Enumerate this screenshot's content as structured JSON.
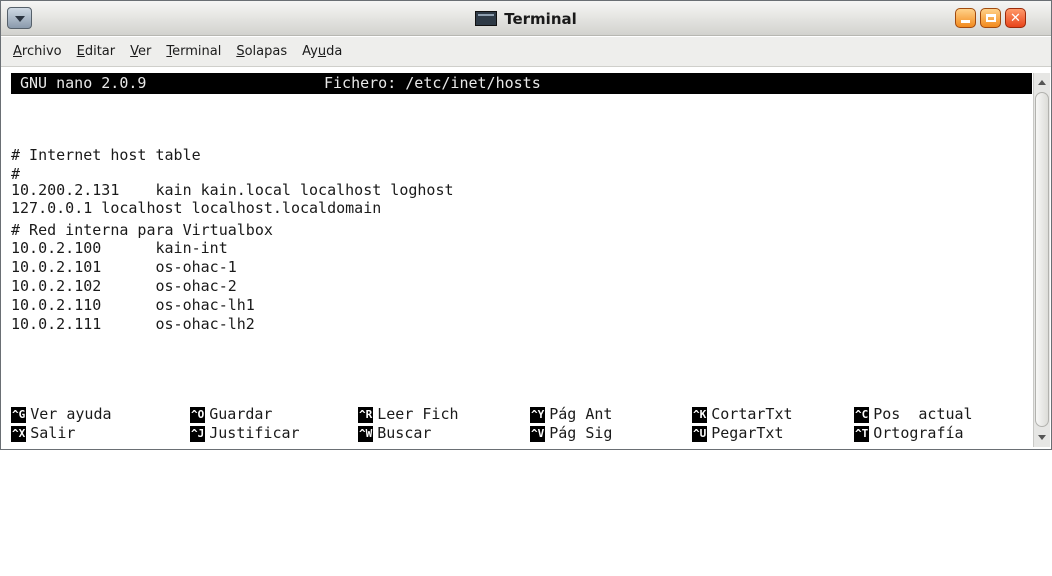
{
  "window": {
    "title": "Terminal",
    "controls": [
      "minimize-icon",
      "maximize-icon",
      "close-icon"
    ]
  },
  "menubar": {
    "items": [
      {
        "pre": "",
        "u": "A",
        "post": "rchivo"
      },
      {
        "pre": "",
        "u": "E",
        "post": "ditar"
      },
      {
        "pre": "",
        "u": "V",
        "post": "er"
      },
      {
        "pre": "",
        "u": "T",
        "post": "erminal"
      },
      {
        "pre": "",
        "u": "S",
        "post": "olapas"
      },
      {
        "pre": "Ay",
        "u": "u",
        "post": "da"
      }
    ]
  },
  "nano": {
    "version": "GNU nano 2.0.9",
    "file_label": "Fichero: /etc/inet/hosts"
  },
  "content": {
    "lines": [
      "",
      "# Internet host table",
      "#",
      "10.200.2.131    kain kain.local localhost loghost",
      "127.0.0.1 localhost localhost.localdomain",
      "",
      "# Red interna para Virtualbox",
      "10.0.2.100      kain-int",
      "10.0.2.101      os-ohac-1",
      "10.0.2.102      os-ohac-2",
      "10.0.2.110      os-ohac-lh1",
      "10.0.2.111      os-ohac-lh2"
    ]
  },
  "shortcuts": {
    "row1": [
      {
        "key": "^G",
        "label": "Ver ayuda"
      },
      {
        "key": "^O",
        "label": "Guardar"
      },
      {
        "key": "^R",
        "label": "Leer Fich"
      },
      {
        "key": "^Y",
        "label": "Pág Ant"
      },
      {
        "key": "^K",
        "label": "CortarTxt"
      },
      {
        "key": "^C",
        "label": "Pos  actual"
      }
    ],
    "row2": [
      {
        "key": "^X",
        "label": "Salir"
      },
      {
        "key": "^J",
        "label": "Justificar"
      },
      {
        "key": "^W",
        "label": "Buscar"
      },
      {
        "key": "^V",
        "label": "Pág Sig"
      },
      {
        "key": "^U",
        "label": "PegarTxt"
      },
      {
        "key": "^T",
        "label": "Ortografía"
      }
    ]
  }
}
